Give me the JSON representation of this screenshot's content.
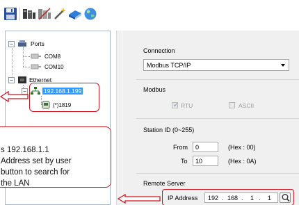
{
  "toolbar": {
    "icons": [
      "save-icon",
      "connect-icon",
      "disconnect-icon",
      "wand-icon",
      "book-icon",
      "globe-icon"
    ]
  },
  "tree": {
    "ports_label": "Ports",
    "com8_label": "COM8",
    "com10_label": "COM10",
    "ethernet_label": "Ethernet",
    "ip_node_label": "192.168.1.199",
    "device_node_label": "(*)1819"
  },
  "connection": {
    "title": "Connection",
    "selected": "Modbus TCP/IP"
  },
  "modbus": {
    "title": "Modbus",
    "rtu_label": "RTU",
    "ascii_label": "ASCII",
    "rtu_checked": true,
    "ascii_checked": false
  },
  "station": {
    "title": "Station ID (0~255)",
    "from_label": "From",
    "from_value": "0",
    "from_hex": "(Hex : 00)",
    "to_label": "To",
    "to_value": "10",
    "to_hex": "(Hex : 0A)"
  },
  "remote": {
    "title": "Remote Server",
    "ip_label": "IP Address",
    "ip_octets": [
      "192",
      "168",
      "1",
      "1"
    ]
  },
  "callout": {
    "line1": "s 192.168.1.1",
    "line2": "Address set by user",
    "line3": "button to search for",
    "line4": "the LAN"
  },
  "colors": {
    "annotation_red": "#d2141e",
    "selection_blue": "#3399ff",
    "panel_gray": "#f0f0f0"
  }
}
